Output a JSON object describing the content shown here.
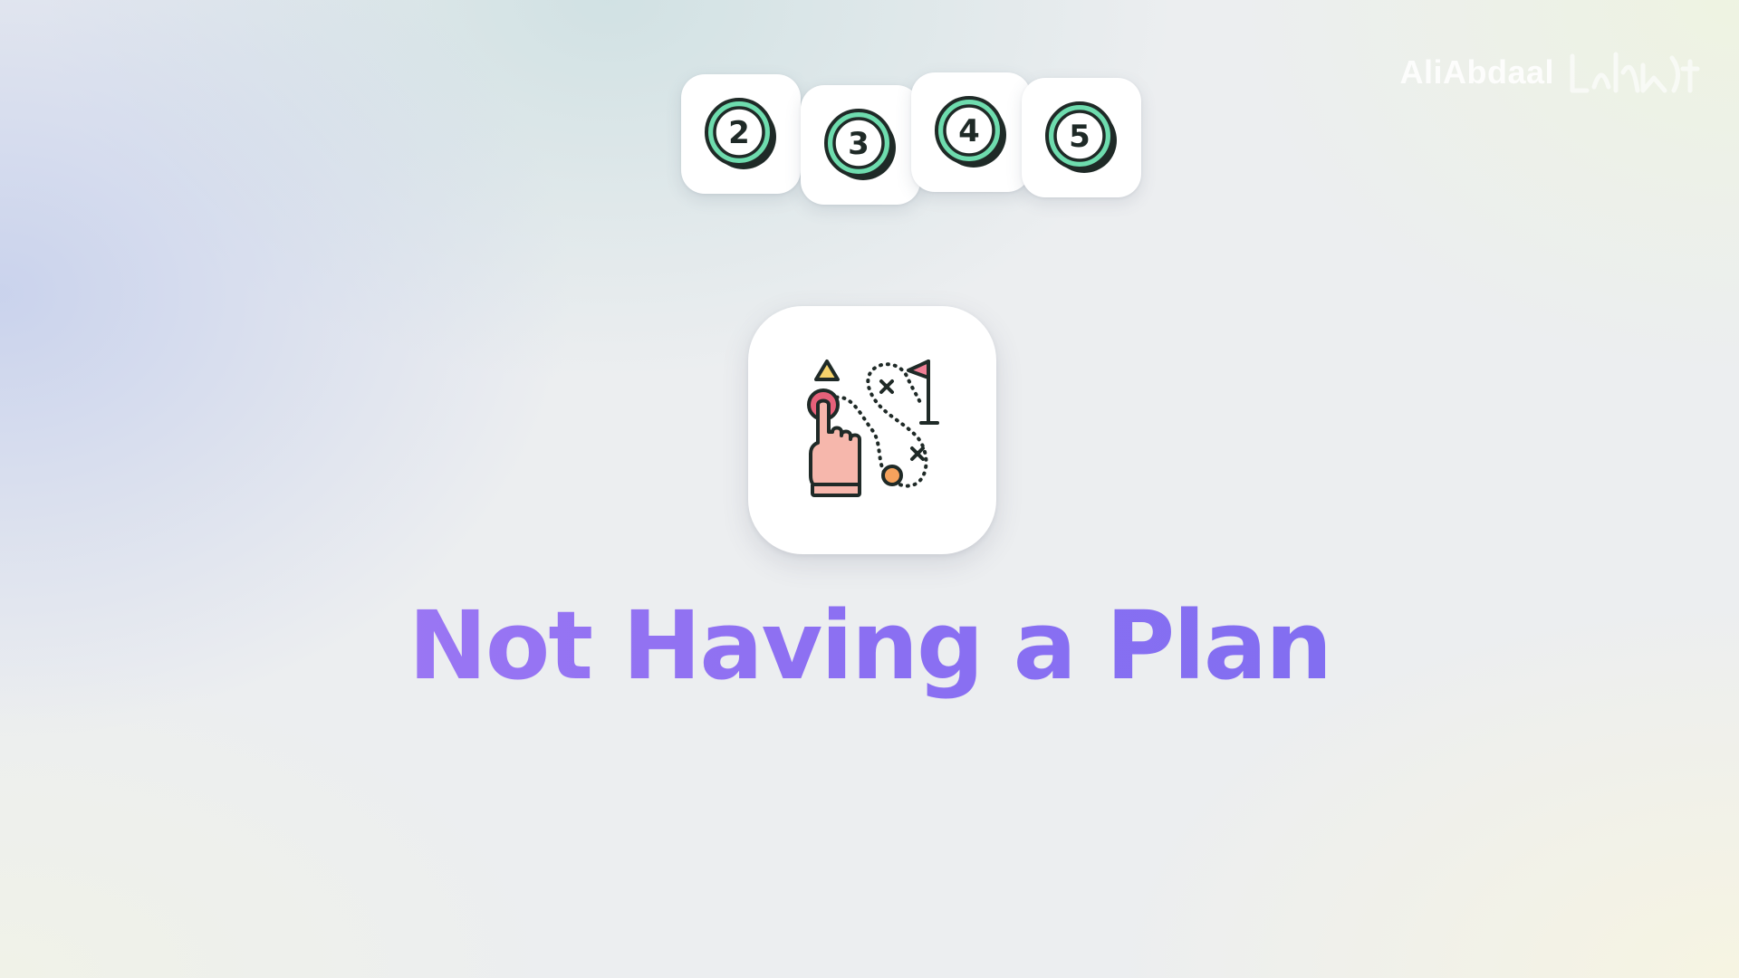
{
  "watermark": {
    "text": "AliAbdaal",
    "logo_icon": "signature-logo-icon"
  },
  "steps": [
    {
      "label": "2",
      "icon": "number-coin-icon"
    },
    {
      "label": "3",
      "icon": "number-coin-icon"
    },
    {
      "label": "4",
      "icon": "number-coin-icon"
    },
    {
      "label": "5",
      "icon": "number-coin-icon"
    }
  ],
  "main_icon": "strategy-map-icon",
  "title": "Not Having a Plan",
  "colors": {
    "coin_fill": "#6edcae",
    "coin_outline": "#1f2a27",
    "title_gradient_start": "#a77cf4",
    "title_gradient_end": "#7a6ef0",
    "card_background": "#ffffff"
  }
}
